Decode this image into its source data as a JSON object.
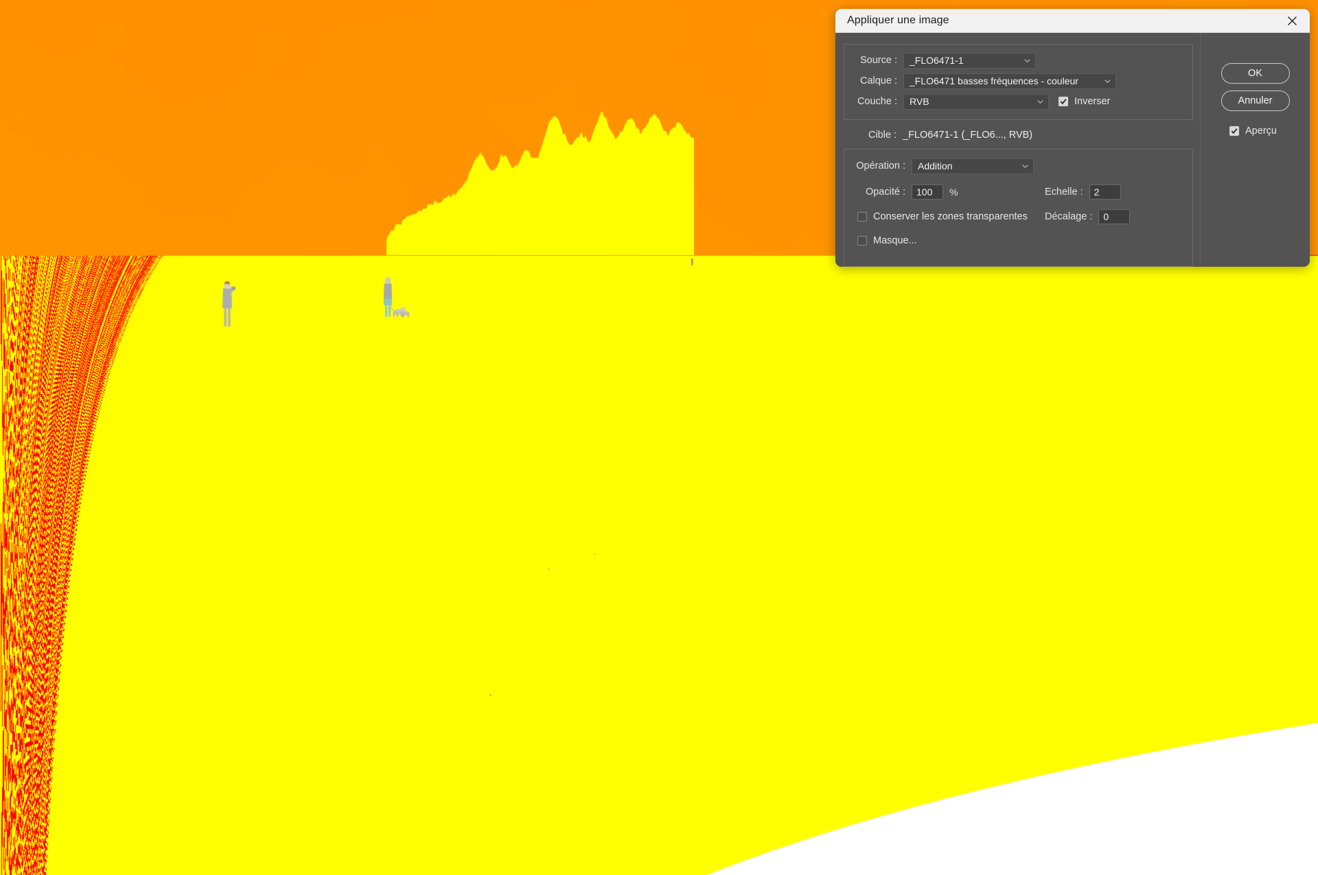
{
  "window": {
    "title": "Appliquer une image",
    "close_icon": "close-icon"
  },
  "source_group": {
    "source_label": "Source :",
    "source_value": "_FLO6471-1",
    "calque_label": "Calque :",
    "calque_value": "_FLO6471 basses fréquences - couleur",
    "couche_label": "Couche :",
    "couche_value": "RVB",
    "inverser_label": "Inverser",
    "inverser_checked": true
  },
  "target": {
    "cible_label": "Cible :",
    "cible_value": "_FLO6471-1 (_FLO6..., RVB)"
  },
  "operation_group": {
    "operation_label": "Opération :",
    "operation_value": "Addition",
    "opacite_label": "Opacité :",
    "opacite_value": "100",
    "opacite_unit": "%",
    "echelle_label": "Echelle :",
    "echelle_value": "2",
    "decalage_label": "Décalage :",
    "decalage_value": "0",
    "conserver_label": "Conserver les zones transparentes",
    "conserver_checked": false,
    "masque_label": "Masque...",
    "masque_checked": false
  },
  "buttons": {
    "ok_label": "OK",
    "cancel_label": "Annuler",
    "apercu_label": "Aperçu",
    "apercu_checked": true
  },
  "colors": {
    "dialog_bg": "#535353",
    "titlebar_bg": "#f1f1f1",
    "field_bg": "#464646",
    "input_bg": "#3d3d3d",
    "text": "#e7e7e7",
    "photo_base_gray": "#8f8f8f",
    "sky_gray": "#919191"
  },
  "photo": {
    "description": "high-pass filtered beach scene",
    "subjects": [
      "person-standing",
      "person-with-dog",
      "rocky-headland"
    ]
  }
}
